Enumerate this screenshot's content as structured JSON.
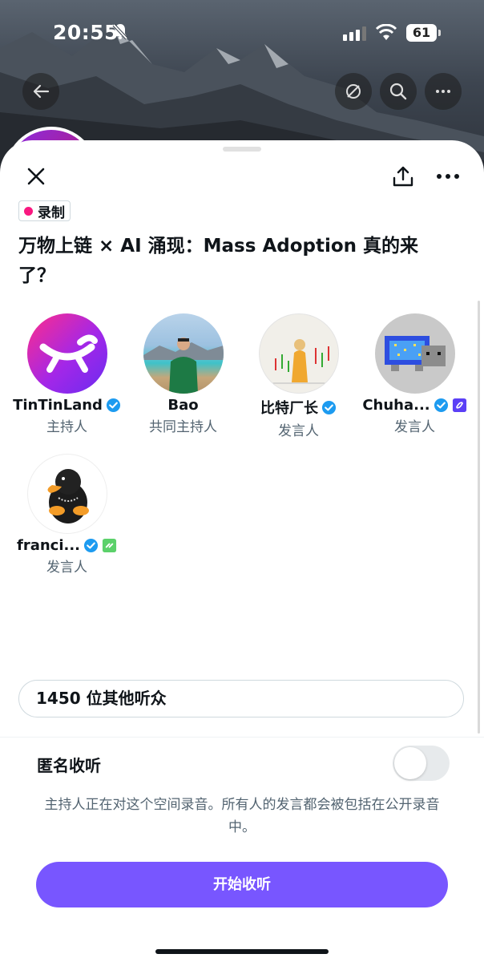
{
  "status_bar": {
    "time": "20:55",
    "battery": "61"
  },
  "space": {
    "badge": "录制",
    "title": "万物上链 × AI 涌现：Mass Adoption 真的来了？"
  },
  "speakers": [
    {
      "name": "TinTinLand",
      "role": "主持人",
      "verified": true
    },
    {
      "name": "Bao",
      "role": "共同主持人",
      "verified": false
    },
    {
      "name": "比特厂长",
      "role": "发言人",
      "verified": true
    },
    {
      "name": "Chuha...",
      "role": "发言人",
      "verified": true
    },
    {
      "name": "franci...",
      "role": "发言人",
      "verified": true
    }
  ],
  "listeners_text": "1450 位其他听众",
  "anonymous": {
    "label": "匿名收听",
    "enabled": false
  },
  "notice": "主持人正在对这个空间录音。所有人的发言都会被包括在公开录音中。",
  "start_button": "开始收听",
  "colors": {
    "accent": "#7856ff",
    "recording": "#f91880",
    "verified": "#1d9bf0"
  }
}
